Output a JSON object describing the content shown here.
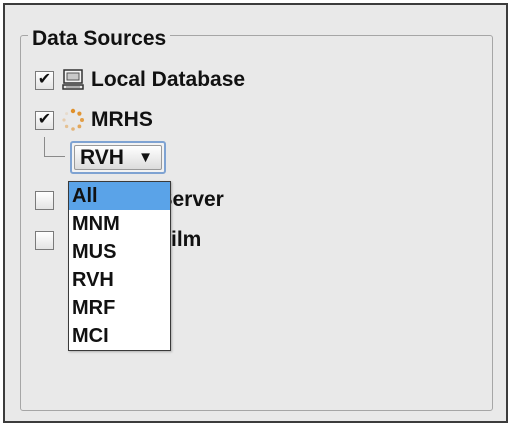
{
  "group": {
    "title": "Data Sources"
  },
  "sources": [
    {
      "label": "Local Database",
      "checked": true,
      "icon": "computer-icon"
    },
    {
      "label": "MRHS",
      "checked": true,
      "icon": "spinner-icon"
    },
    {
      "label": "Test Server",
      "checked": false,
      "visible_label": "Test Server"
    },
    {
      "label": "film",
      "checked": false,
      "visible_label": "film"
    }
  ],
  "check_glyph": "✔",
  "combo": {
    "selected": "RVH",
    "arrow": "▼"
  },
  "dropdown": {
    "options": [
      "All",
      "MNM",
      "MUS",
      "RVH",
      "MRF",
      "MCI"
    ],
    "highlighted": "All"
  },
  "colors": {
    "highlight": "#5aa3e8",
    "focus_ring": "#7fa3d2",
    "spinner": "#e0902a"
  }
}
